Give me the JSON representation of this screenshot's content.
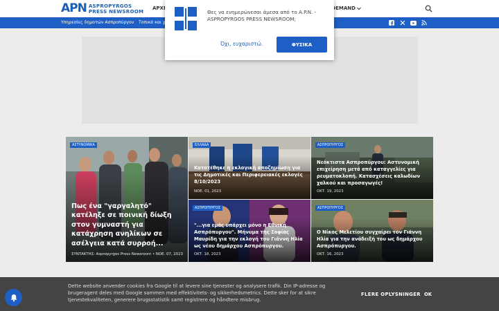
{
  "header": {
    "logo_mark": "APN",
    "logo_line1": "ASPROPYRGOS",
    "logo_line2": "PRESS NEWSROOM",
    "nav_home": "ΑΡΧΙ",
    "nav_ondemand": "N DEMAND",
    "search_icon": "search-icon"
  },
  "subnav": {
    "items": [
      "Υπηρεσίες δημοτών Ασπροπύργου",
      "Τοπικά και χ"
    ],
    "social_icons": [
      "facebook-icon",
      "x-icon",
      "youtube-icon",
      "rss-icon"
    ]
  },
  "popup": {
    "message": "Θες να ενημερώνεσαι άμεσα από το A.P.N. - ASPROPYRGOS PRESS NEWSROOM;",
    "decline_label": "Όχι, ευχαριστώ.",
    "accept_label": "ΦΥΣΙΚΑ"
  },
  "articles": [
    {
      "tag": "ΑΣΤΥΝΟΜΙΚΑ",
      "title": "Πως ένα \"γαργαλητό\" κατέληξε σε ποινική δίωξη στον γυμναστή για κατάχρηση ανηλίκων σε ασέλγεια κατά συρροή...",
      "meta": "ΣΥΝΤΑΚΤΗΣ: Aspropyrgos Press Newsroom • ΝΟΕ. 07, 2023"
    },
    {
      "tag": "ΕΛΛΑΔΑ",
      "title": "Κατατέθηκε η εκλογική αποζημίωση για τις Δημοτικές και Περιφερειακές εκλογές 8/10/2023",
      "meta": "ΝΟΕ. 01, 2023"
    },
    {
      "tag": "ΑΣΠΡΟΠΥΡΓΟΣ",
      "title": "Νεόκτιστα Ασπροπύργου: Αστυνομική επιχείρηση μετά από καταγγελίες για ρευματοκλοπή. Κατασχέσεις καλωδίων χαλκού και προσαγωγές!",
      "meta": "ΟΚΤ. 19, 2023"
    },
    {
      "tag": "ΑΣΠΡΟΠΥΡΓΟΣ",
      "title": "\"...για εμάς υπάρχει μόνο η Εθνική Ασπρόπυργου\". Μήνυμα της Σοφίας Μαυρίδη για την εκλογή του Γιάννη Ηλία ως νέου δημάρχου Ασπρόπυργου.",
      "meta": "ΟΚΤ. 18, 2023"
    },
    {
      "tag": "ΑΣΠΡΟΠΥΡΓΟΣ",
      "title": "Ο Νίκος Μελετίου συγχαίρει τον Γιάννη Ηλία για την ανάδειξή του ως δημάρχου Ασπρόπυργου.",
      "meta": "ΟΚΤ. 16, 2023"
    }
  ],
  "cookie": {
    "text": "Dette website anvender cookies fra Google til at levere sine tjenester og analysere trafik. Din IP-adresse og brugeragent deles med Google sammen med effektivitets- og sikkerhedsmetrics. Dette sker for at sikre tjenestekvaliteten, generere brugsstatistik samt registrere og håndtere misbrug.",
    "more_label": "FLERE OPLYSNINGER",
    "ok_label": "OK"
  },
  "colors": {
    "brand_blue": "#1d5fc4",
    "cookie_bg": "#444444"
  }
}
